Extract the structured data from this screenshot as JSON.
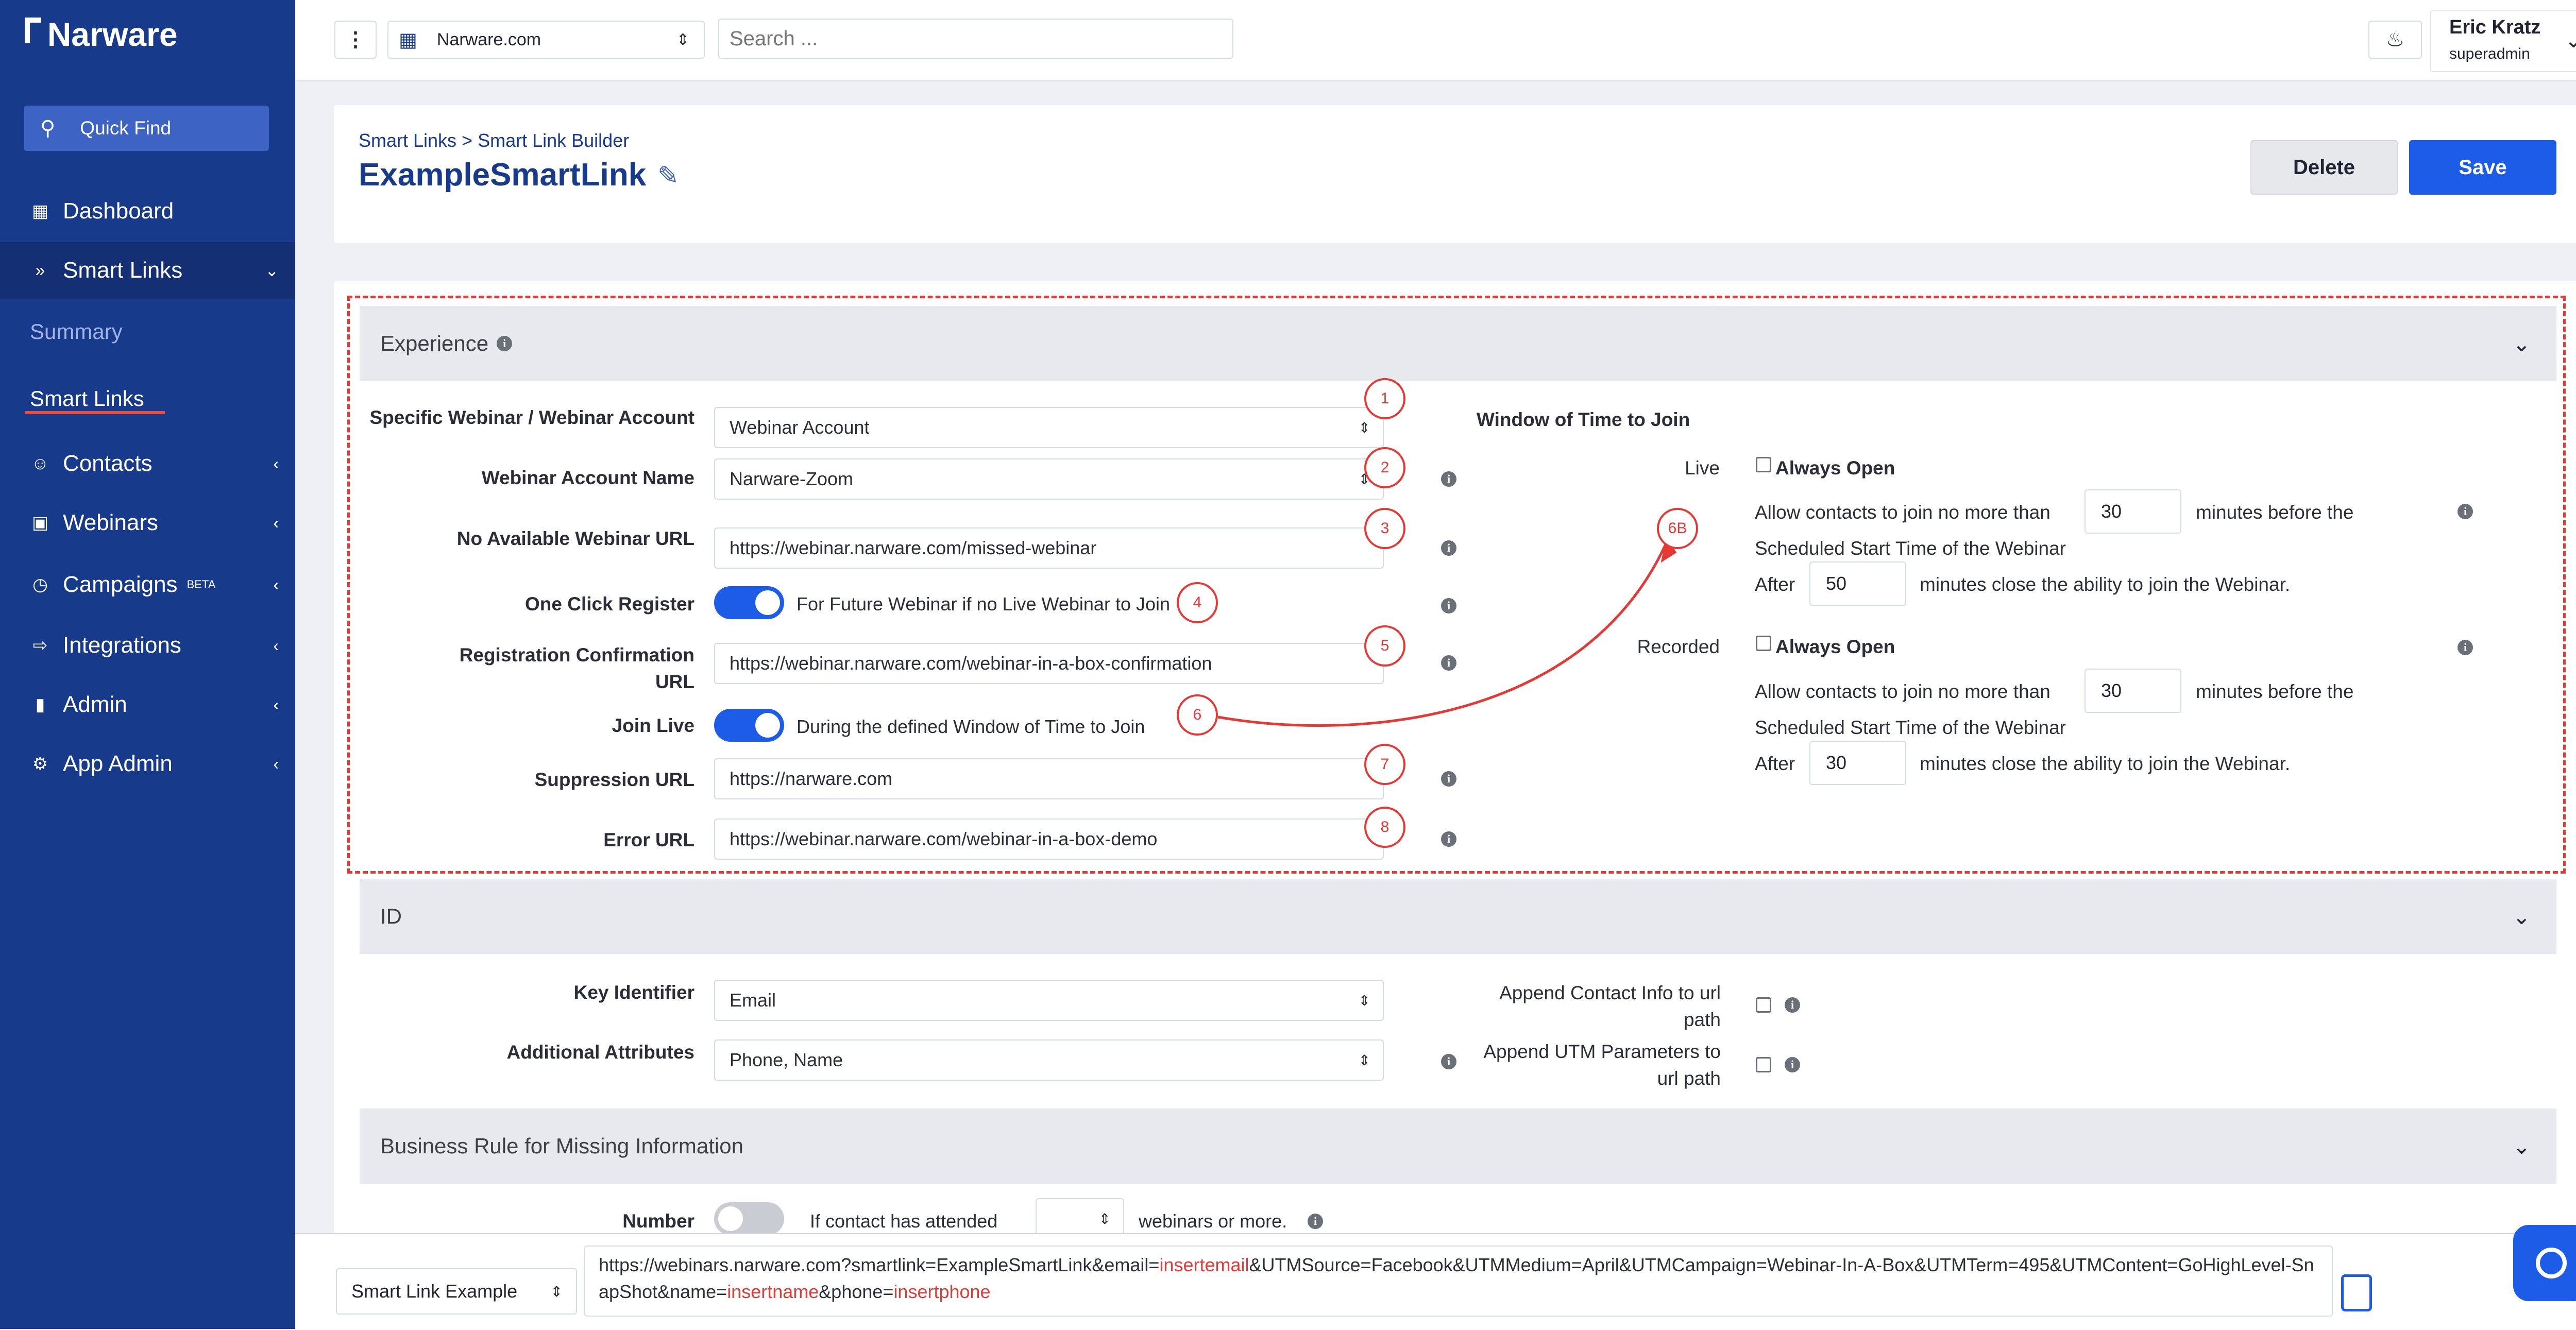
{
  "app": {
    "name": "Narware"
  },
  "sidebar": {
    "quick_find": "Quick Find",
    "items": [
      {
        "label": "Dashboard",
        "icon": "dashboard-icon"
      },
      {
        "label": "Smart Links",
        "icon": "double-chevron-icon"
      },
      {
        "label": "Contacts",
        "icon": "users-icon"
      },
      {
        "label": "Webinars",
        "icon": "video-icon"
      },
      {
        "label": "Campaigns",
        "icon": "clock-icon",
        "badge": "BETA"
      },
      {
        "label": "Integrations",
        "icon": "sign-in-icon"
      },
      {
        "label": "Admin",
        "icon": "badge-icon"
      },
      {
        "label": "App Admin",
        "icon": "users-cog-icon"
      }
    ],
    "sub_items": [
      "Summary",
      "Smart Links"
    ]
  },
  "topbar": {
    "site": "Narware.com",
    "search_placeholder": "Search ...",
    "user_name": "Eric Kratz",
    "user_role": "superadmin"
  },
  "header": {
    "breadcrumb": "Smart Links > Smart Link Builder",
    "title": "ExampleSmartLink",
    "delete_label": "Delete",
    "save_label": "Save"
  },
  "experience": {
    "section_title": "Experience",
    "specific_label": "Specific Webinar / Webinar Account",
    "specific_value": "Webinar Account",
    "account_name_label": "Webinar Account Name",
    "account_name_value": "Narware-Zoom",
    "no_webinar_label": "No Available Webinar URL",
    "no_webinar_value": "https://webinar.narware.com/missed-webinar",
    "one_click_label": "One Click Register",
    "one_click_text": "For Future Webinar if no Live Webinar to Join",
    "reg_conf_label_1": "Registration Confirmation",
    "reg_conf_label_2": "URL",
    "reg_conf_value": "https://webinar.narware.com/webinar-in-a-box-confirmation",
    "join_live_label": "Join Live",
    "join_live_text": "During the defined Window of Time to Join",
    "suppression_label": "Suppression URL",
    "suppression_value": "https://narware.com",
    "error_label": "Error URL",
    "error_value": "https://webinar.narware.com/webinar-in-a-box-demo",
    "annotations": [
      "1",
      "2",
      "3",
      "4",
      "5",
      "6",
      "7",
      "8",
      "6B"
    ],
    "window": {
      "title": "Window of Time to Join",
      "live_label": "Live",
      "recorded_label": "Recorded",
      "always_open": "Always Open",
      "before_text_1": "Allow contacts to join no more than",
      "before_text_2": "minutes before the",
      "scheduled_text": "Scheduled Start Time of the Webinar",
      "after_label": "After",
      "after_text": "minutes close the ability to join the Webinar.",
      "live_before": "30",
      "live_after": "50",
      "rec_before": "30",
      "rec_after": "30"
    }
  },
  "id_section": {
    "section_title": "ID",
    "key_label": "Key Identifier",
    "key_value": "Email",
    "attr_label": "Additional Attributes",
    "attr_value": "Phone, Name",
    "append_contact_1": "Append Contact Info to url",
    "append_contact_2": "path",
    "append_utm_1": "Append UTM Parameters to",
    "append_utm_2": "url path"
  },
  "business": {
    "section_title": "Business Rule for Missing Information",
    "number_label": "Number",
    "if_text": "If contact has attended",
    "webinars_text": "webinars or more."
  },
  "bottom": {
    "example_select": "Smart Link Example",
    "url_parts": [
      {
        "text": "https://webinars.narware.com?smartlink=ExampleSmartLink&email=",
        "red": false
      },
      {
        "text": "insertemail",
        "red": true
      },
      {
        "text": "&UTMSource=Facebook&UTMMedium=April&UTMCampaign=Webinar-In-A-Box&UTMTerm=495&UTMContent=GoHighLevel-SnapShot&name=",
        "red": false
      },
      {
        "text": "insertname",
        "red": true
      },
      {
        "text": "&phone=",
        "red": false
      },
      {
        "text": "insertphone",
        "red": true
      }
    ]
  },
  "colors": {
    "sidebar": "#173a8a",
    "accent": "#1d5ce6",
    "annotation": "#e53935"
  }
}
